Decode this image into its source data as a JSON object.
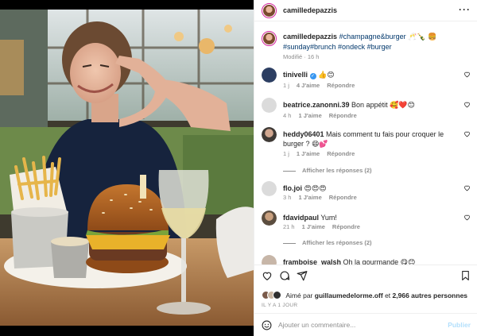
{
  "post": {
    "username": "camilledepazzis",
    "more_label": "···"
  },
  "caption": {
    "username": "camilledepazzis",
    "tags": "#champagne&burger",
    "emojis": "🥂🍾 🍔",
    "tags2": "#sunday#brunch #ondeck #burger",
    "time": "Modifié · 16 h"
  },
  "comments": [
    {
      "username": "tinivelli",
      "text": "👍😊",
      "meta_time": "1 j",
      "meta_likes": "4 J'aime",
      "meta_reply": "Répondre",
      "verified": true
    },
    {
      "username": "beatrice.zanonni.39",
      "text": "Bon appétit 🥰❤️😊",
      "meta_time": "4 h",
      "meta_likes": "1 J'aime",
      "meta_reply": "Répondre"
    },
    {
      "username": "heddy06401",
      "text": "Mais comment tu fais pour croquer le burger ? 😄💕",
      "meta_time": "1 j",
      "meta_likes": "1 J'aime",
      "meta_reply": "Répondre",
      "replies": "Afficher les réponses (2)"
    },
    {
      "username": "flo.joi",
      "text": "😍😍😍",
      "meta_time": "3 h",
      "meta_likes": "1 J'aime",
      "meta_reply": "Répondre"
    },
    {
      "username": "fdavidpaul",
      "text": "Yum!",
      "meta_time": "21 h",
      "meta_likes": "1 J'aime",
      "meta_reply": "Répondre",
      "replies": "Afficher les réponses (2)"
    },
    {
      "username": "framboise_walsh",
      "text": "Oh la gourmande 😋😊"
    }
  ],
  "likes": {
    "prefix": "Aimé par ",
    "user": "guillaumedelorme.off",
    "middle": " et ",
    "count": "2,966 autres personnes"
  },
  "date": "IL Y A 1 JOUR",
  "add_comment": {
    "placeholder": "Ajouter un commentaire...",
    "post_label": "Publier"
  },
  "icons": {
    "like": "heart-icon",
    "comment": "comment-icon",
    "share": "share-icon",
    "save": "bookmark-icon",
    "emoji": "emoji-icon"
  }
}
